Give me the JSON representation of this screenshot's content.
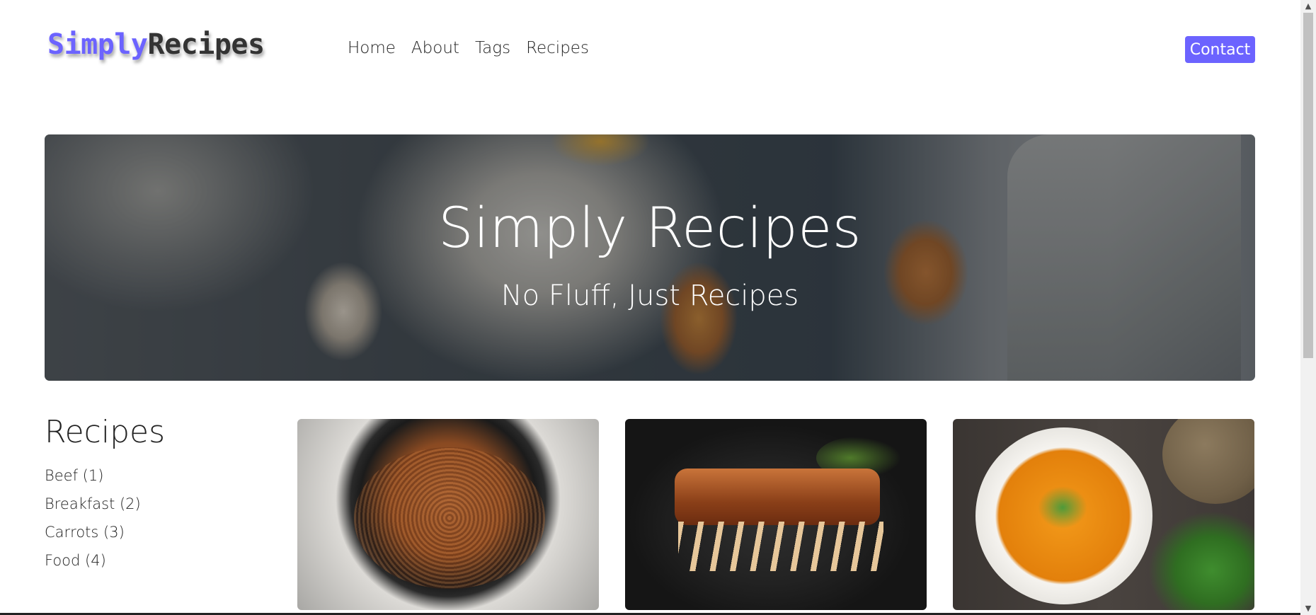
{
  "navbar": {
    "logo_accent": "Simply",
    "logo_main": "Recipes",
    "links": [
      "Home",
      "About",
      "Tags",
      "Recipes"
    ],
    "contact_label": "Contact"
  },
  "hero": {
    "title": "Simply Recipes",
    "subtitle": "No Fluff, Just Recipes"
  },
  "sidebar": {
    "title": "Recipes",
    "tags": [
      {
        "label": "Beef (1)"
      },
      {
        "label": "Breakfast (2)"
      },
      {
        "label": "Carrots (3)"
      },
      {
        "label": "Food (4)"
      }
    ]
  },
  "colors": {
    "accent": "#6c63ff",
    "text": "#222222"
  },
  "icons": {
    "scroll_up": "scroll-up-arrow",
    "scroll_down": "scroll-down-arrow"
  }
}
